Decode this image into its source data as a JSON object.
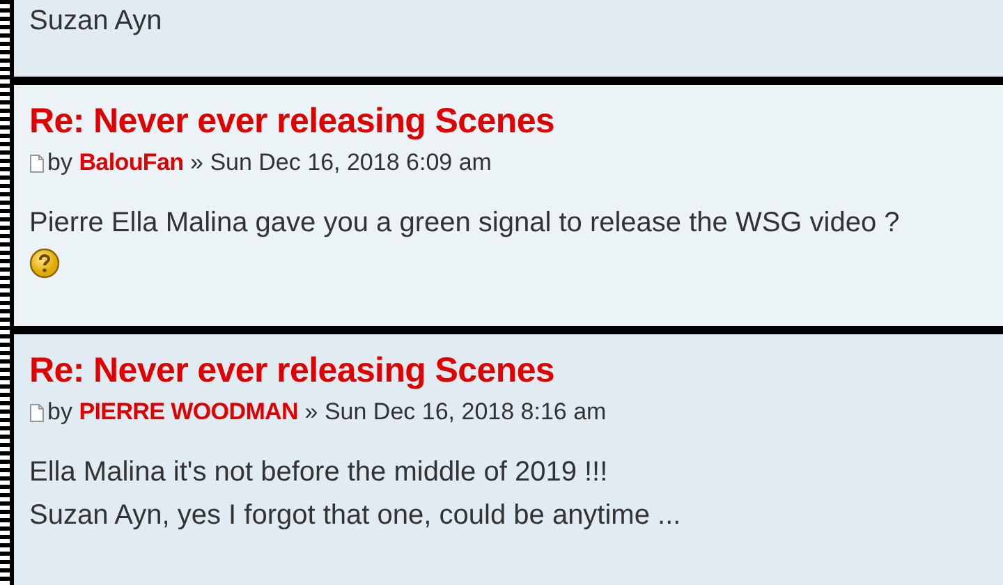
{
  "posts": [
    {
      "body": [
        {
          "kind": "text",
          "text": "Suzan Ayn"
        }
      ]
    },
    {
      "title": "Re: Never ever releasing Scenes",
      "author": "BalouFan",
      "date": "Sun Dec 16, 2018 6:09 am",
      "by": "by",
      "separator": "»",
      "body": [
        {
          "kind": "text",
          "text": "Pierre Ella Malina gave you a green signal to release the WSG video ?"
        },
        {
          "kind": "smiley"
        }
      ]
    },
    {
      "title": "Re: Never ever releasing Scenes",
      "author": "PIERRE WOODMAN",
      "date": "Sun Dec 16, 2018 8:16 am",
      "by": "by",
      "separator": "»",
      "body": [
        {
          "kind": "text",
          "text": "Ella Malina it's not before the middle of 2019 !!!"
        },
        {
          "kind": "text",
          "text": "Suzan Ayn, yes I forgot that one, could be anytime ..."
        }
      ]
    }
  ]
}
